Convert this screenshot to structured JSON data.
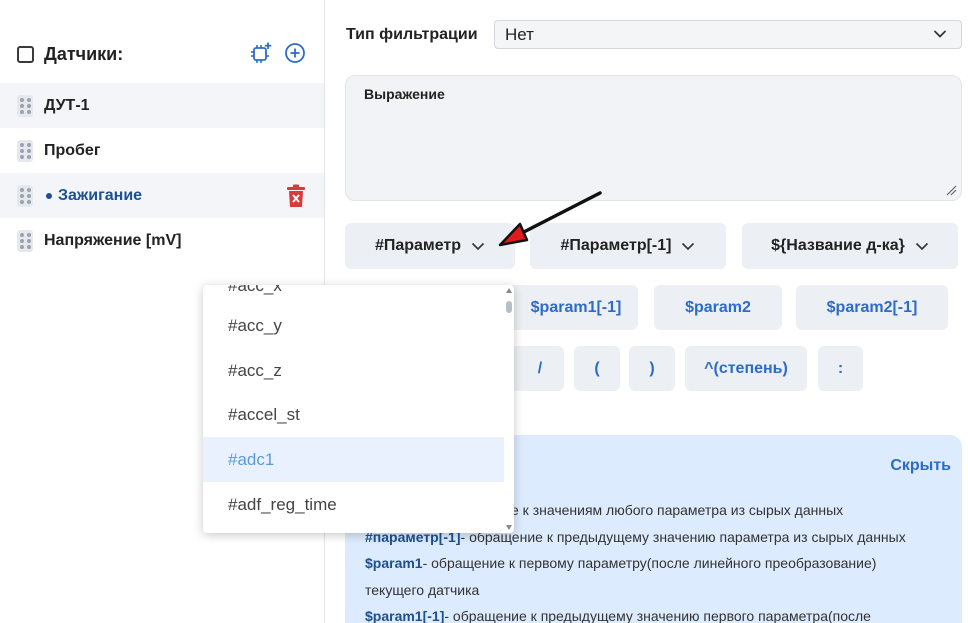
{
  "sidebar": {
    "title": "Датчики:",
    "items": [
      {
        "label": "ДУТ-1"
      },
      {
        "label": "Пробег"
      },
      {
        "label": "Зажигание"
      },
      {
        "label": "Напряжение [mV]"
      }
    ]
  },
  "filter": {
    "label": "Тип фильтрации",
    "value": "Нет"
  },
  "expression": {
    "label": "Выражение"
  },
  "param_buttons": [
    {
      "label": "#Параметр"
    },
    {
      "label": "#Параметр[-1]"
    },
    {
      "label": "${Название д-ка}"
    }
  ],
  "token_buttons_row1": [
    "$param1[-1]",
    "$param2",
    "$param2[-1]"
  ],
  "token_buttons_row2": [
    "/",
    "(",
    ")",
    "^(степень)",
    ":"
  ],
  "dropdown": {
    "partial_top": "#acc_x",
    "items": [
      "#acc_y",
      "#acc_z",
      "#accel_st",
      "#adc1",
      "#adf_reg_time"
    ],
    "highlighted": "#adc1"
  },
  "info": {
    "hide_label": "Скрыть",
    "lines": [
      {
        "bold": "",
        "text": "е к значениям любого параметра из сырых данных"
      },
      {
        "bold": "#параметр[-1]",
        "text": "- обращение к предыдущему значению параметра из сырых данных"
      },
      {
        "bold": "$param1",
        "text": "- обращение к первому параметру(после линейного преобразование)"
      },
      {
        "bold": "",
        "text": "текущего датчика"
      },
      {
        "bold": "$param1[-1]",
        "text": "- обращение к предыдущему значению первого параметра(после"
      }
    ]
  },
  "colors": {
    "accent": "#2c6cc9",
    "active_text": "#1e4f8f",
    "delete": "#d93a3a",
    "panel_bg": "#dcebfd"
  }
}
